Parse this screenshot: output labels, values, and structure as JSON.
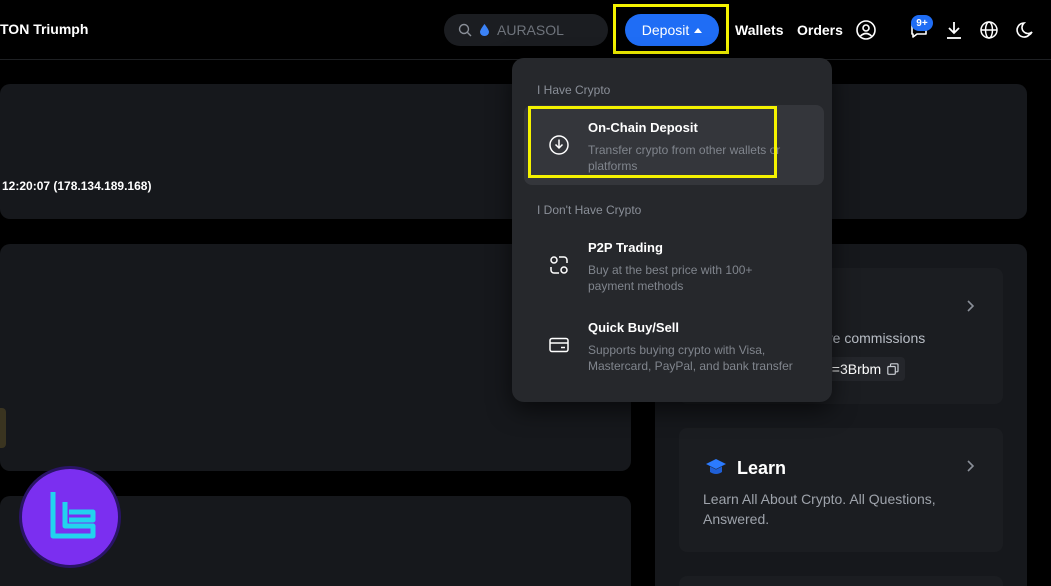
{
  "header": {
    "brand": "TON Triumph",
    "search_placeholder": "AURASOL",
    "deposit_label": "Deposit",
    "nav": {
      "wallets": "Wallets",
      "orders": "Orders"
    },
    "notification_badge": "9+",
    "accent_color": "#1f6df5",
    "highlight_color": "#f4f200"
  },
  "account": {
    "last_login": "12:20:07 (178.134.189.168)"
  },
  "deposit_menu": {
    "section_have": "I Have Crypto",
    "section_dont_have": "I Don't Have Crypto",
    "items": [
      {
        "icon": "download-circle-icon",
        "title": "On-Chain Deposit",
        "desc": "Transfer crypto from other wallets or platforms"
      },
      {
        "icon": "p2p-icon",
        "title": "P2P Trading",
        "desc": "Buy at the best price with 100+ payment methods"
      },
      {
        "icon": "card-icon",
        "title": "Quick Buy/Sell",
        "desc": "Supports buying crypto with Visa, Mastercard, PayPal, and bank transfer"
      }
    ]
  },
  "referral": {
    "partial_text": "re commissions",
    "code": "=3Brbm"
  },
  "learn": {
    "title": "Learn",
    "desc": "Learn All About Crypto. All Questions, Answered."
  }
}
